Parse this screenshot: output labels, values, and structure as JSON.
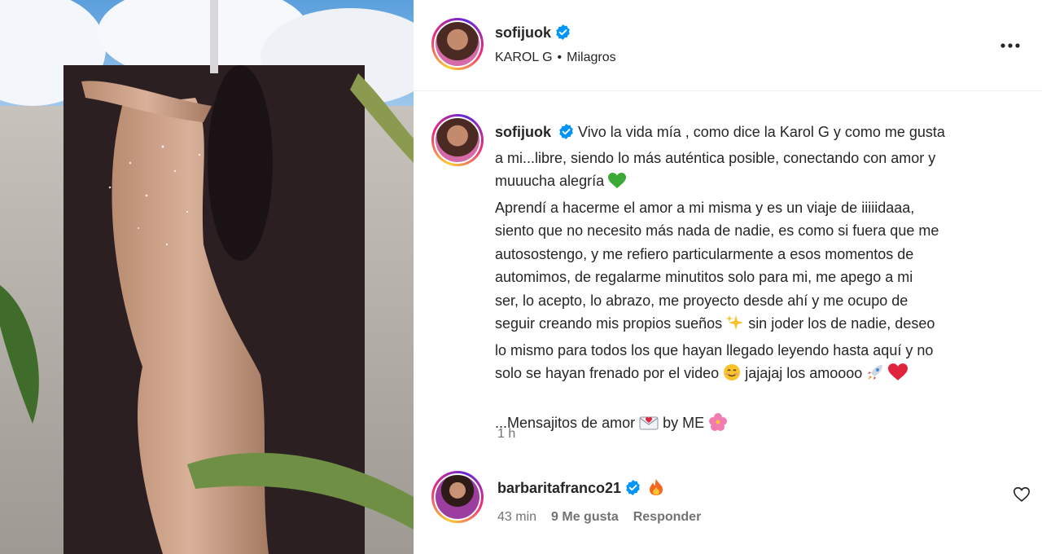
{
  "post": {
    "author": "sofijuok",
    "audio_artist": "KAROL G",
    "audio_separator": "•",
    "audio_song": "Milagros"
  },
  "caption": {
    "author": "sofijuok",
    "line1": "Vivo la vida mía , como dice la Karol G y como me gusta",
    "line2": "a mi...libre, siendo lo más auténtica posible, conectando con amor y",
    "line3": "muuucha alegría",
    "para2a": "Aprendí a hacerme el amor a mi misma y es un viaje de iiiiidaaa,\nsiento que no necesito más nada de nadie, es como si fuera que me\nautosostengo, y me refiero particularmente a esos momentos de\nautomimos, de regalarme minutitos solo para mi, me apego a mi\nser, lo acepto, lo abrazo, me proyecto desde ahí y me ocupo de\nseguir creando mis propios sueños",
    "para2b": "sin joder los de nadie, deseo",
    "para2c": "lo mismo para todos los que hayan llegado leyendo hasta aquí y no",
    "para2d": "solo se hayan frenado por el video",
    "para2e": "jajajaj los amoooo",
    "closing_a": "...Mensajitos de amor",
    "closing_b": "by ME",
    "time": "1 h"
  },
  "comment": {
    "author": "barbaritafranco21",
    "time": "43 min",
    "likes": "9 Me gusta",
    "reply": "Responder"
  },
  "icons": {
    "verified": "verified-badge-icon",
    "more": "more-options-icon",
    "heart": "heart-outline-icon",
    "green_heart": "green-heart-emoji",
    "sparkles": "sparkles-emoji",
    "smile": "smiling-face-emoji",
    "rocket": "rocket-emoji",
    "red_heart": "red-heart-emoji",
    "love_letter": "love-letter-emoji",
    "hibiscus": "hibiscus-emoji",
    "fire": "fire-emoji"
  },
  "colors": {
    "verified_blue": "#0095f6",
    "muted_text": "#737373"
  }
}
